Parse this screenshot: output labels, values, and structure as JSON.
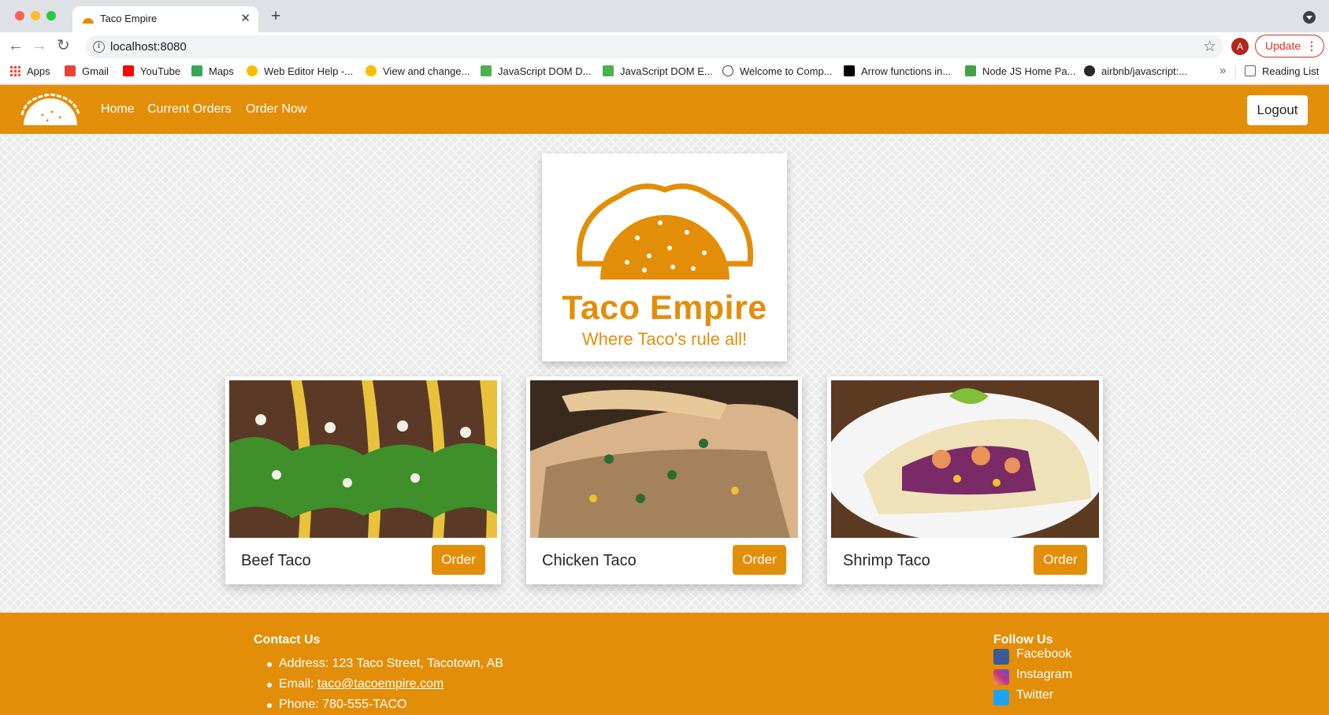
{
  "browser": {
    "tab_title": "Taco Empire",
    "url": "localhost:8080",
    "avatar_letter": "A",
    "update_label": "Update",
    "bookmarks": [
      {
        "label": "Apps",
        "color": "#4285f4"
      },
      {
        "label": "Gmail",
        "color": "#ea4335"
      },
      {
        "label": "YouTube",
        "color": "#ff0000"
      },
      {
        "label": "Maps",
        "color": "#34a853"
      },
      {
        "label": "Web Editor Help -...",
        "color": "#fbbc04"
      },
      {
        "label": "View and change...",
        "color": "#fbbc04"
      },
      {
        "label": "JavaScript DOM D...",
        "color": "#4caf50"
      },
      {
        "label": "JavaScript DOM E...",
        "color": "#4caf50"
      },
      {
        "label": "Welcome to Comp...",
        "color": "#3c4043"
      },
      {
        "label": "Arrow functions in...",
        "color": "#000000"
      },
      {
        "label": "Node JS Home Pa...",
        "color": "#43a047"
      },
      {
        "label": "airbnb/javascript:...",
        "color": "#24292e"
      }
    ],
    "more_bookmarks": "»",
    "reading_list": "Reading List"
  },
  "nav": {
    "links": [
      "Home",
      "Current Orders",
      "Order Now"
    ],
    "logout_label": "Logout"
  },
  "hero": {
    "title": "Taco Empire",
    "subtitle": "Where Taco's rule all!"
  },
  "menu": [
    {
      "name": "Beef Taco",
      "button": "Order"
    },
    {
      "name": "Chicken Taco",
      "button": "Order"
    },
    {
      "name": "Shrimp Taco",
      "button": "Order"
    }
  ],
  "footer": {
    "contact_heading": "Contact Us",
    "address": "Address: 123 Taco Street, Tacotown, AB",
    "email_prefix": "Email: ",
    "email": "taco@tacoempire.com",
    "phone": "Phone: 780-555-TACO",
    "follow_heading": "Follow Us",
    "social": [
      {
        "label": "Facebook",
        "icon": "facebook-icon",
        "color": "#3b5998"
      },
      {
        "label": "Instagram",
        "icon": "instagram-icon",
        "color": "#c13584"
      },
      {
        "label": "Twitter",
        "icon": "twitter-icon",
        "color": "#1da1f2"
      }
    ]
  },
  "colors": {
    "brand": "#e38e09",
    "page_bg": "#ebebeb"
  }
}
